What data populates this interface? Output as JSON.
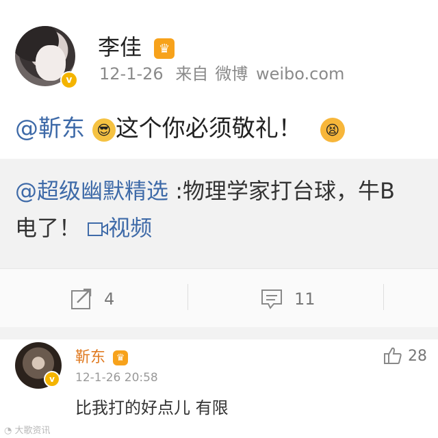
{
  "post": {
    "author": "李佳",
    "date": "12-1-26",
    "source_prefix": "来自",
    "source_name": "微博",
    "source_domain": "weibo.com",
    "mention": "@靳东",
    "text": "这个你必须敬礼！"
  },
  "repost": {
    "mention": "@超级幽默精选",
    "text_line1": " :物理学家打台球，牛B",
    "text_line2": "电了！",
    "video_label": "视频"
  },
  "actions": {
    "repost_count": "4",
    "comment_count": "11"
  },
  "comment": {
    "author": "靳东",
    "time": "12-1-26 20:58",
    "text": "比我打的好点儿  有限",
    "like_count": "28"
  },
  "watermark": "大歌资讯",
  "colors": {
    "mention": "#3e6aa8",
    "verified_badge": "#f4b400",
    "crown_badge": "#f7a21b",
    "comment_author": "#e07b22"
  }
}
